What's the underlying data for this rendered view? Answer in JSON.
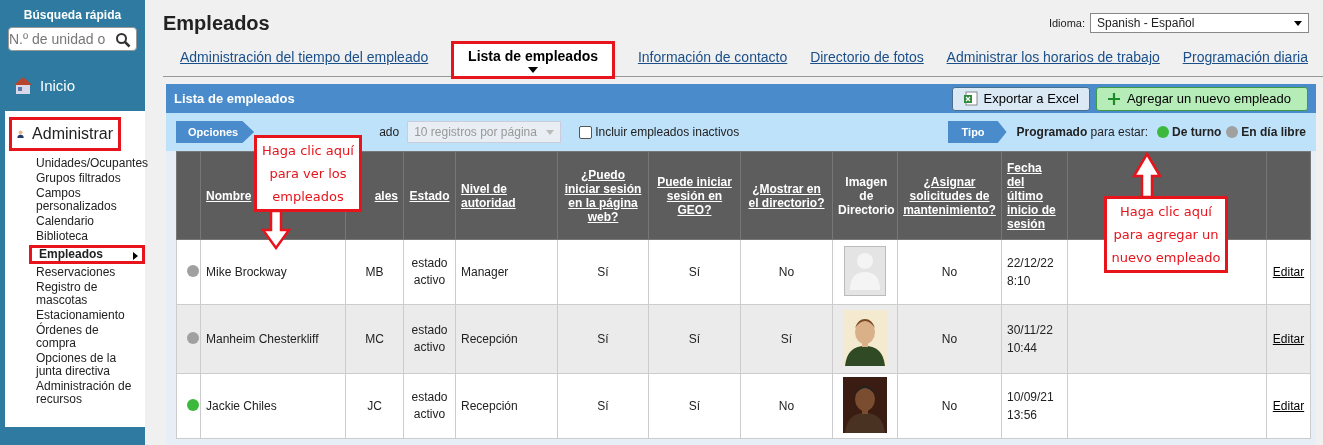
{
  "sidebar": {
    "search_title": "Búsqueda rápida",
    "search": {
      "placeholder": "N.º de unidad o"
    },
    "home": "Inicio",
    "section": {
      "label": "Administrar",
      "highlighted": true
    },
    "items": [
      {
        "label": "Unidades/Ocupantes",
        "selected": false,
        "highlighted": false
      },
      {
        "label": "Grupos filtrados",
        "selected": false,
        "highlighted": false
      },
      {
        "label": "Campos personalizados",
        "selected": false,
        "highlighted": false
      },
      {
        "label": "Calendario",
        "selected": false,
        "highlighted": false
      },
      {
        "label": "Biblioteca",
        "selected": false,
        "highlighted": false
      },
      {
        "label": "Empleados",
        "selected": true,
        "highlighted": true
      },
      {
        "label": "Reservaciones",
        "selected": false,
        "highlighted": false
      },
      {
        "label": "Registro de mascotas",
        "selected": false,
        "highlighted": false
      },
      {
        "label": "Estacionamiento",
        "selected": false,
        "highlighted": false
      },
      {
        "label": "Órdenes de compra",
        "selected": false,
        "highlighted": false
      },
      {
        "label": "Opciones de la junta directiva",
        "selected": false,
        "highlighted": false
      },
      {
        "label": "Administración de recursos",
        "selected": false,
        "highlighted": false
      }
    ]
  },
  "page": {
    "title": "Empleados",
    "language_label": "Idioma:",
    "language": "Spanish - Español"
  },
  "tabs": [
    {
      "label": "Administración del tiempo del empleado",
      "selected": false,
      "highlighted": false
    },
    {
      "label": "Lista de empleados",
      "selected": true,
      "highlighted": true
    },
    {
      "label": "Información de contacto",
      "selected": false,
      "highlighted": false
    },
    {
      "label": "Directorio de fotos",
      "selected": false,
      "highlighted": false
    },
    {
      "label": "Administrar los horarios de trabajo",
      "selected": false,
      "highlighted": false
    },
    {
      "label": "Programación diaria",
      "selected": false,
      "highlighted": false
    }
  ],
  "panel": {
    "title": "Lista de empleados",
    "export_button": "Exportar a Excel",
    "add_button": "Agregar un nuevo empleado",
    "options_label": "Opciones",
    "options_text": "ado",
    "page_size": "10 registros por página",
    "include_inactive": {
      "label": "Incluir empleados inactivos",
      "checked": false
    },
    "type_label": "Tipo",
    "legend_text": "**Programado** para estar:",
    "legend": [
      {
        "label": "De turno",
        "color": "#3cb93c"
      },
      {
        "label": "En día libre",
        "color": "#a0a0a0"
      }
    ]
  },
  "table": {
    "columns": [
      {},
      {
        "label": "Nombre",
        "link": true
      },
      {
        "label": "ales",
        "link": true
      },
      {
        "label": "Estado",
        "link": true
      },
      {
        "label": "Nivel de autoridad",
        "link": true
      },
      {
        "label": "¿Puedo iniciar sesión en la página web?",
        "link": true
      },
      {
        "label": "Puede iniciar sesión en GEO?",
        "link": true
      },
      {
        "label": "¿Mostrar en el directorio?",
        "link": true
      },
      {
        "label": "Imagen de Directorio",
        "link": false
      },
      {
        "label": "¿Asignar solicitudes de mantenimiento?",
        "link": true
      },
      {
        "label": "Fecha del último inicio de sesión",
        "link": true
      },
      {},
      {}
    ],
    "rows": [
      {
        "color": "#a0a0a0",
        "name": "Mike Brockway",
        "initials": "MB",
        "status": "estado activo",
        "authority": "Manager",
        "web": "Sí",
        "geo": "Sí",
        "directory": "No",
        "photo": {
          "kind": "no-photo"
        },
        "maintenance": "No",
        "last_login": "22/12/22 8:10",
        "action": "Editar"
      },
      {
        "color": "#a0a0a0",
        "name": "Manheim Chesterkliff",
        "initials": "MC",
        "status": "estado activo",
        "authority": "Recepción",
        "web": "Sí",
        "geo": "Sí",
        "directory": "Sí",
        "photo": {
          "kind": "light"
        },
        "maintenance": "No",
        "last_login": "30/11/22 10:44",
        "action": "Editar"
      },
      {
        "color": "#3cb93c",
        "name": "Jackie Chiles",
        "initials": "JC",
        "status": "estado activo",
        "authority": "Recepción",
        "web": "Sí",
        "geo": "Sí",
        "directory": "No",
        "photo": {
          "kind": "dark"
        },
        "maintenance": "No",
        "last_login": "10/09/21 13:56",
        "action": "Editar"
      }
    ]
  },
  "callouts": [
    {
      "text": "Haga clic aquí para ver los empleados",
      "kind": "down"
    },
    {
      "text": "Haga clic aquí para agregar un nuevo empleado",
      "kind": "up"
    }
  ]
}
